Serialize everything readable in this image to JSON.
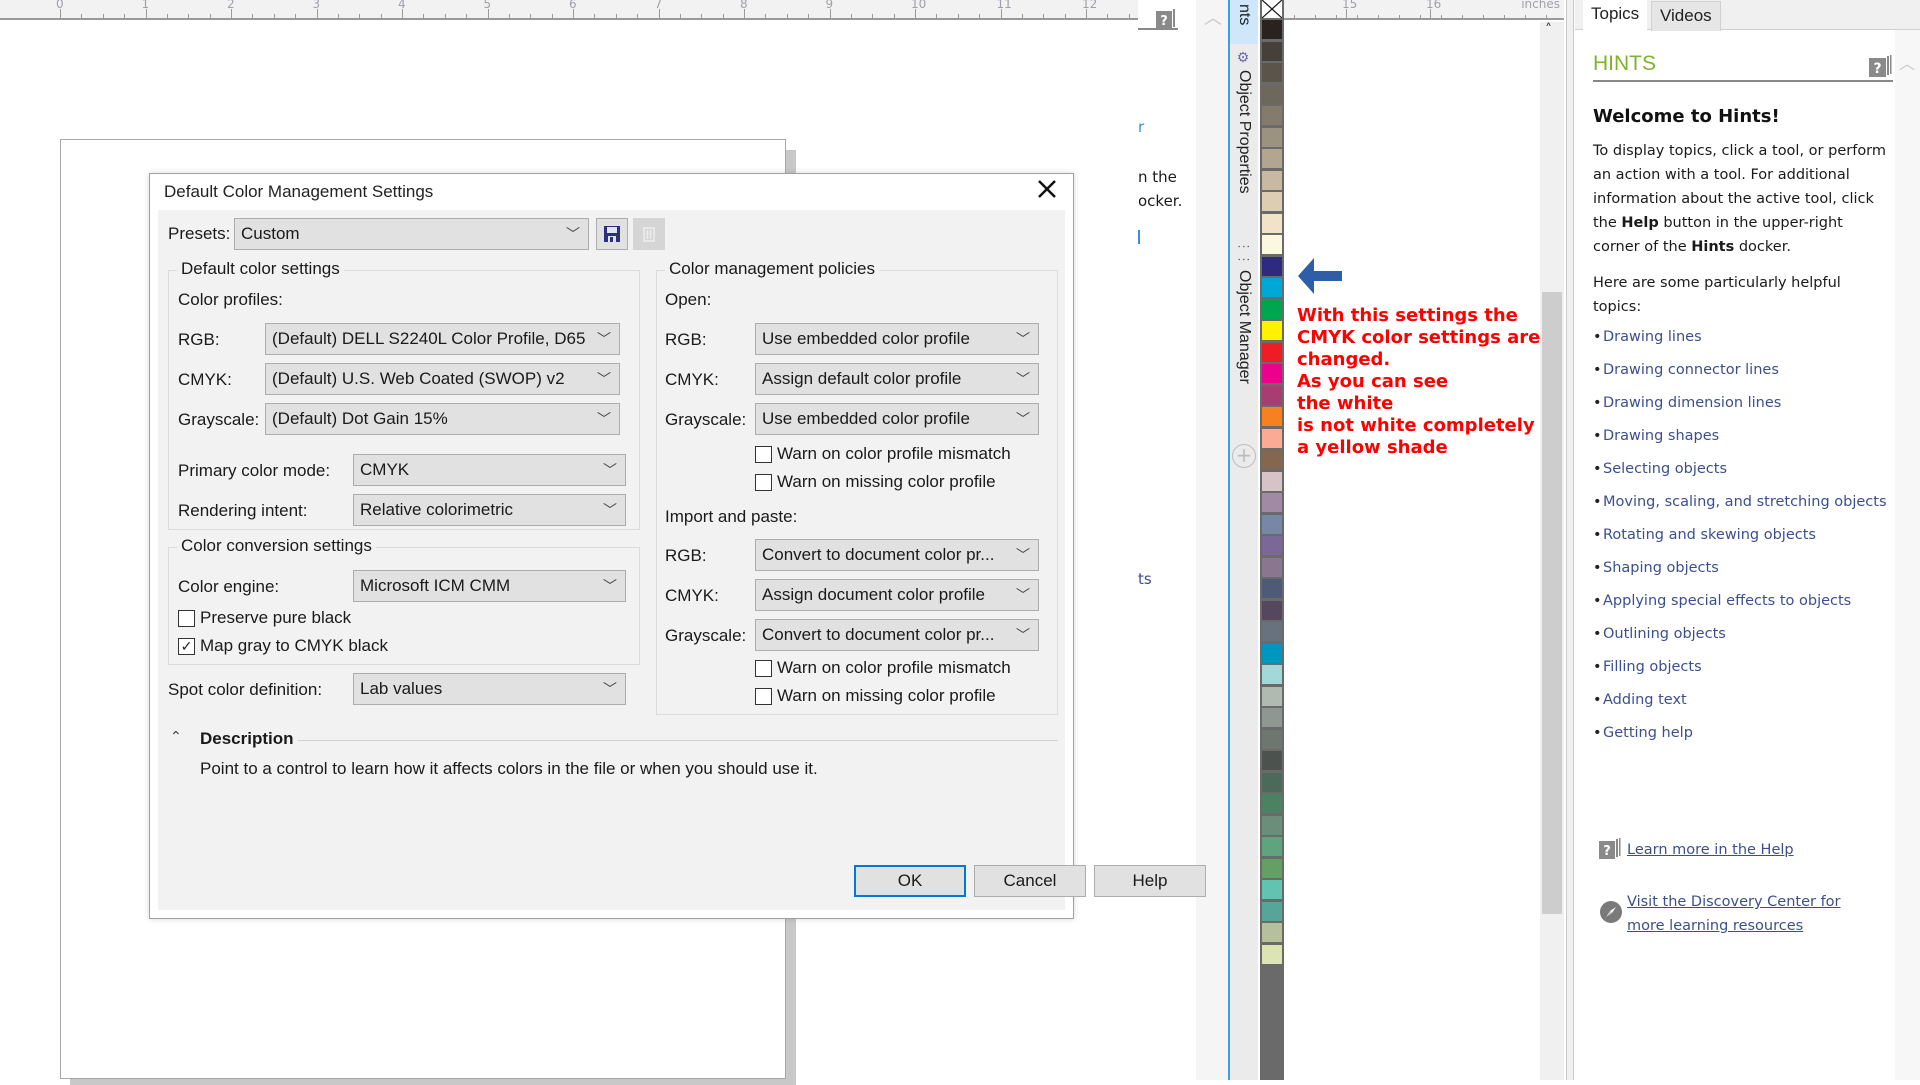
{
  "ruler": {
    "left_labels": [
      "0",
      "1",
      "2",
      "3",
      "4",
      "5",
      "6",
      "7",
      "8",
      "9",
      "10",
      "11",
      "12"
    ],
    "right_labels": [
      "15",
      "16"
    ],
    "unit": "inches"
  },
  "dialog": {
    "title": "Default Color Management Settings",
    "close_label": "✕",
    "presets": {
      "label": "Presets:",
      "value": "Custom",
      "save_icon": "save-icon",
      "delete_icon": "delete-icon"
    },
    "default_color_settings": {
      "group_title": "Default color settings",
      "profiles_label": "Color profiles:",
      "rgb": {
        "label": "RGB:",
        "value": "(Default) DELL S2240L Color Profile, D65"
      },
      "cmyk": {
        "label": "CMYK:",
        "value": "(Default) U.S. Web Coated (SWOP) v2"
      },
      "grayscale": {
        "label": "Grayscale:",
        "value": "(Default) Dot Gain 15%"
      },
      "primary_mode": {
        "label": "Primary color mode:",
        "value": "CMYK"
      },
      "rendering_intent": {
        "label": "Rendering intent:",
        "value": "Relative colorimetric"
      }
    },
    "conversion": {
      "group_title": "Color conversion settings",
      "engine": {
        "label": "Color engine:",
        "value": "Microsoft ICM CMM"
      },
      "preserve_black": {
        "label": "Preserve pure black",
        "checked": false
      },
      "map_gray": {
        "label": "Map gray to CMYK black",
        "checked": true
      }
    },
    "spot": {
      "label": "Spot color definition:",
      "value": "Lab values"
    },
    "policies": {
      "group_title": "Color management policies",
      "open_label": "Open:",
      "open_rgb": {
        "label": "RGB:",
        "value": "Use embedded color profile"
      },
      "open_cmyk": {
        "label": "CMYK:",
        "value": "Assign default color profile"
      },
      "open_gray": {
        "label": "Grayscale:",
        "value": "Use embedded color profile"
      },
      "open_warn_mismatch": {
        "label": "Warn on color profile mismatch",
        "checked": false
      },
      "open_warn_missing": {
        "label": "Warn on missing color profile",
        "checked": false
      },
      "import_label": "Import and paste:",
      "import_rgb": {
        "label": "RGB:",
        "value": "Convert to document color pr..."
      },
      "import_cmyk": {
        "label": "CMYK:",
        "value": "Assign document color profile"
      },
      "import_gray": {
        "label": "Grayscale:",
        "value": "Convert to document color pr..."
      },
      "import_warn_mismatch": {
        "label": "Warn on color profile mismatch",
        "checked": false
      },
      "import_warn_missing": {
        "label": "Warn on missing color profile",
        "checked": false
      }
    },
    "description": {
      "title": "Description",
      "text": "Point to a control to learn how it affects colors in the file or when you should use it."
    },
    "buttons": {
      "ok": "OK",
      "cancel": "Cancel",
      "help": "Help"
    }
  },
  "background_fragments": [
    "r",
    "n the",
    "ocker.",
    "ts"
  ],
  "dockers": {
    "tabs": [
      "nts",
      "Object Properties",
      "Object Manager"
    ],
    "add_icon": "plus-circle-icon"
  },
  "palette": {
    "colors": [
      "#2a221e",
      "#45403a",
      "#5a544b",
      "#6d675c",
      "#847b6d",
      "#9c9280",
      "#b2a690",
      "#c8b9a0",
      "#ddcdb2",
      "#f2e3c8",
      "#fcf8e0",
      "#2e2a7d",
      "#00a8d8",
      "#00a54f",
      "#fff200",
      "#ee1c25",
      "#ec008c",
      "#a83d72",
      "#f7801f",
      "#fbaa96",
      "#85664f",
      "#d6c3c5",
      "#a08aa4",
      "#7687a8",
      "#7b6798",
      "#8b7690",
      "#4e5a76",
      "#564760",
      "#68717e",
      "#0096c2",
      "#a2d8d8",
      "#b0bab0",
      "#8e9890",
      "#6e7670",
      "#4c524e",
      "#4c6a5a",
      "#4a8262",
      "#6a8e7a",
      "#5ea47e",
      "#62a064",
      "#62c4b0",
      "#56a49a",
      "#b6c09c",
      "#dde4b4"
    ]
  },
  "annotation": {
    "text": "With this settings the\nCMYK color settings are\nchanged.\nAs you can see\nthe white\nis not white completely\na yellow shade",
    "color": "#ff0000",
    "arrow_color": "#2f5ea8"
  },
  "hints": {
    "tabs": [
      "Topics",
      "Videos"
    ],
    "title": "HINTS",
    "welcome": "Welcome to Hints!",
    "intro_parts": [
      "To display topics, click a tool, or perform an action with a tool. For additional information about the active tool, click the ",
      "Help",
      " button in the upper-right corner of the ",
      "Hints",
      " docker."
    ],
    "topics_intro": "Here are some particularly helpful topics:",
    "topics": [
      "Drawing lines",
      "Drawing connector lines",
      "Drawing dimension lines",
      "Drawing shapes",
      "Selecting objects",
      "Moving, scaling, and stretching objects",
      "Rotating and skewing objects",
      "Shaping objects",
      "Applying special effects to objects",
      "Outlining objects",
      "Filling objects",
      "Adding text",
      "Getting help"
    ],
    "learn_more": "Learn more in the Help",
    "discovery": "Visit the Discovery Center for more learning resources",
    "title_color": "#7db42b",
    "link_color": "#3b4f8f"
  }
}
